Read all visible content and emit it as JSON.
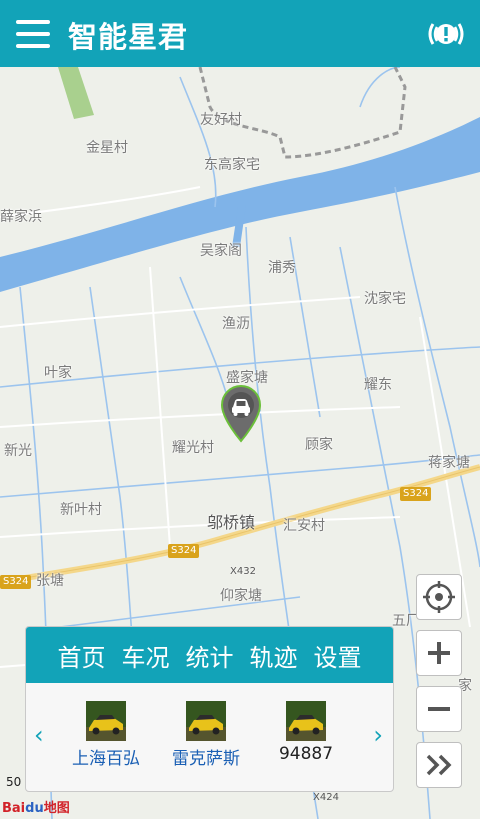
{
  "header": {
    "title": "智能星君"
  },
  "map": {
    "places": [
      {
        "name": "友好村"
      },
      {
        "name": "金星村"
      },
      {
        "name": "东高家宅"
      },
      {
        "name": "薛家浜"
      },
      {
        "name": "吴家阁"
      },
      {
        "name": "浦秀"
      },
      {
        "name": "沈家宅"
      },
      {
        "name": "渔沥"
      },
      {
        "name": "叶家"
      },
      {
        "name": "盛家塘"
      },
      {
        "name": "耀东"
      },
      {
        "name": "新光"
      },
      {
        "name": "耀光村"
      },
      {
        "name": "顾家"
      },
      {
        "name": "蒋家塘"
      },
      {
        "name": "新叶村"
      },
      {
        "name": "邬桥镇"
      },
      {
        "name": "汇安村"
      },
      {
        "name": "张塘"
      },
      {
        "name": "仰家塘"
      },
      {
        "name": "五厂"
      },
      {
        "name": "家"
      }
    ],
    "roads": [
      "S324",
      "S324",
      "S324",
      "X432"
    ],
    "scale": "50",
    "bottom_road": "X424",
    "logo_text_red": "Bai",
    "logo_text_blue": "du",
    "logo_suffix": "地图"
  },
  "panel": {
    "tabs": [
      "首页",
      "车况",
      "统计",
      "轨迹",
      "设置"
    ],
    "vehicles": [
      {
        "name": "上海百弘"
      },
      {
        "name": "雷克萨斯"
      },
      {
        "name": "94887"
      }
    ],
    "prev_arrow": "‹",
    "next_arrow": "›"
  },
  "colors": {
    "brand": "#12a3b8",
    "river": "#7fb3e8",
    "road_yellow": "#f4d78a",
    "link": "#1a5fb4"
  }
}
